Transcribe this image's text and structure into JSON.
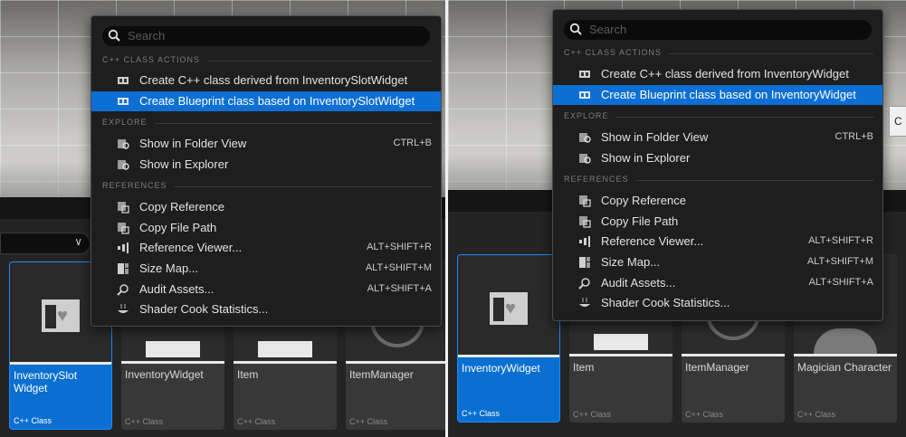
{
  "left": {
    "menu": {
      "search_placeholder": "Search",
      "sections": [
        "C++ CLASS ACTIONS",
        "EXPLORE",
        "REFERENCES"
      ],
      "class_actions": [
        {
          "label": "Create C++ class derived from InventorySlotWidget",
          "icon": "cpp-class-icon"
        },
        {
          "label": "Create Blueprint class based on InventorySlotWidget",
          "icon": "cpp-class-icon",
          "highlighted": true
        }
      ],
      "explore": [
        {
          "label": "Show in Folder View",
          "shortcut": "CTRL+B",
          "icon": "folder-search-icon"
        },
        {
          "label": "Show in Explorer",
          "shortcut": "",
          "icon": "folder-search-icon"
        }
      ],
      "references": [
        {
          "label": "Copy Reference",
          "shortcut": "",
          "icon": "copy-reference-icon"
        },
        {
          "label": "Copy File Path",
          "shortcut": "",
          "icon": "copy-path-icon"
        },
        {
          "label": "Reference Viewer...",
          "shortcut": "ALT+SHIFT+R",
          "icon": "reference-viewer-icon"
        },
        {
          "label": "Size Map...",
          "shortcut": "ALT+SHIFT+M",
          "icon": "size-map-icon"
        },
        {
          "label": "Audit Assets...",
          "shortcut": "ALT+SHIFT+A",
          "icon": "audit-icon"
        },
        {
          "label": "Shader Cook Statistics...",
          "shortcut": "",
          "icon": "shader-stats-icon"
        }
      ]
    },
    "tiles": [
      {
        "name": "InventorySlot Widget",
        "type": "C++ Class",
        "selected": true
      },
      {
        "name": "InventoryWidget",
        "type": "C++ Class"
      },
      {
        "name": "Item",
        "type": "C++ Class"
      },
      {
        "name": "ItemManager",
        "type": "C++ Class"
      }
    ]
  },
  "right": {
    "menu": {
      "search_placeholder": "Search",
      "sections": [
        "C++ CLASS ACTIONS",
        "EXPLORE",
        "REFERENCES"
      ],
      "class_actions": [
        {
          "label": "Create C++ class derived from InventoryWidget",
          "icon": "cpp-class-icon"
        },
        {
          "label": "Create Blueprint class based on InventoryWidget",
          "icon": "cpp-class-icon",
          "highlighted": true
        }
      ],
      "explore": [
        {
          "label": "Show in Folder View",
          "shortcut": "CTRL+B",
          "icon": "folder-search-icon"
        },
        {
          "label": "Show in Explorer",
          "shortcut": "",
          "icon": "folder-search-icon"
        }
      ],
      "references": [
        {
          "label": "Copy Reference",
          "shortcut": "",
          "icon": "copy-reference-icon"
        },
        {
          "label": "Copy File Path",
          "shortcut": "",
          "icon": "copy-path-icon"
        },
        {
          "label": "Reference Viewer...",
          "shortcut": "ALT+SHIFT+R",
          "icon": "reference-viewer-icon"
        },
        {
          "label": "Size Map...",
          "shortcut": "ALT+SHIFT+M",
          "icon": "size-map-icon"
        },
        {
          "label": "Audit Assets...",
          "shortcut": "ALT+SHIFT+A",
          "icon": "audit-icon"
        },
        {
          "label": "Shader Cook Statistics...",
          "shortcut": "",
          "icon": "shader-stats-icon"
        }
      ]
    },
    "tiles": [
      {
        "name": "InventoryWidget",
        "type": "C++ Class",
        "selected": true
      },
      {
        "name": "Item",
        "type": "C++ Class"
      },
      {
        "name": "ItemManager",
        "type": "C++ Class"
      },
      {
        "name": "Magician Character",
        "type": "C++ Class"
      }
    ],
    "tooltip_text": "C"
  },
  "colors": {
    "highlight": "#0d6fd4",
    "menu_bg": "#1e1e1e",
    "tile_bg": "#383838",
    "selected_tile": "#0a6fd1"
  }
}
